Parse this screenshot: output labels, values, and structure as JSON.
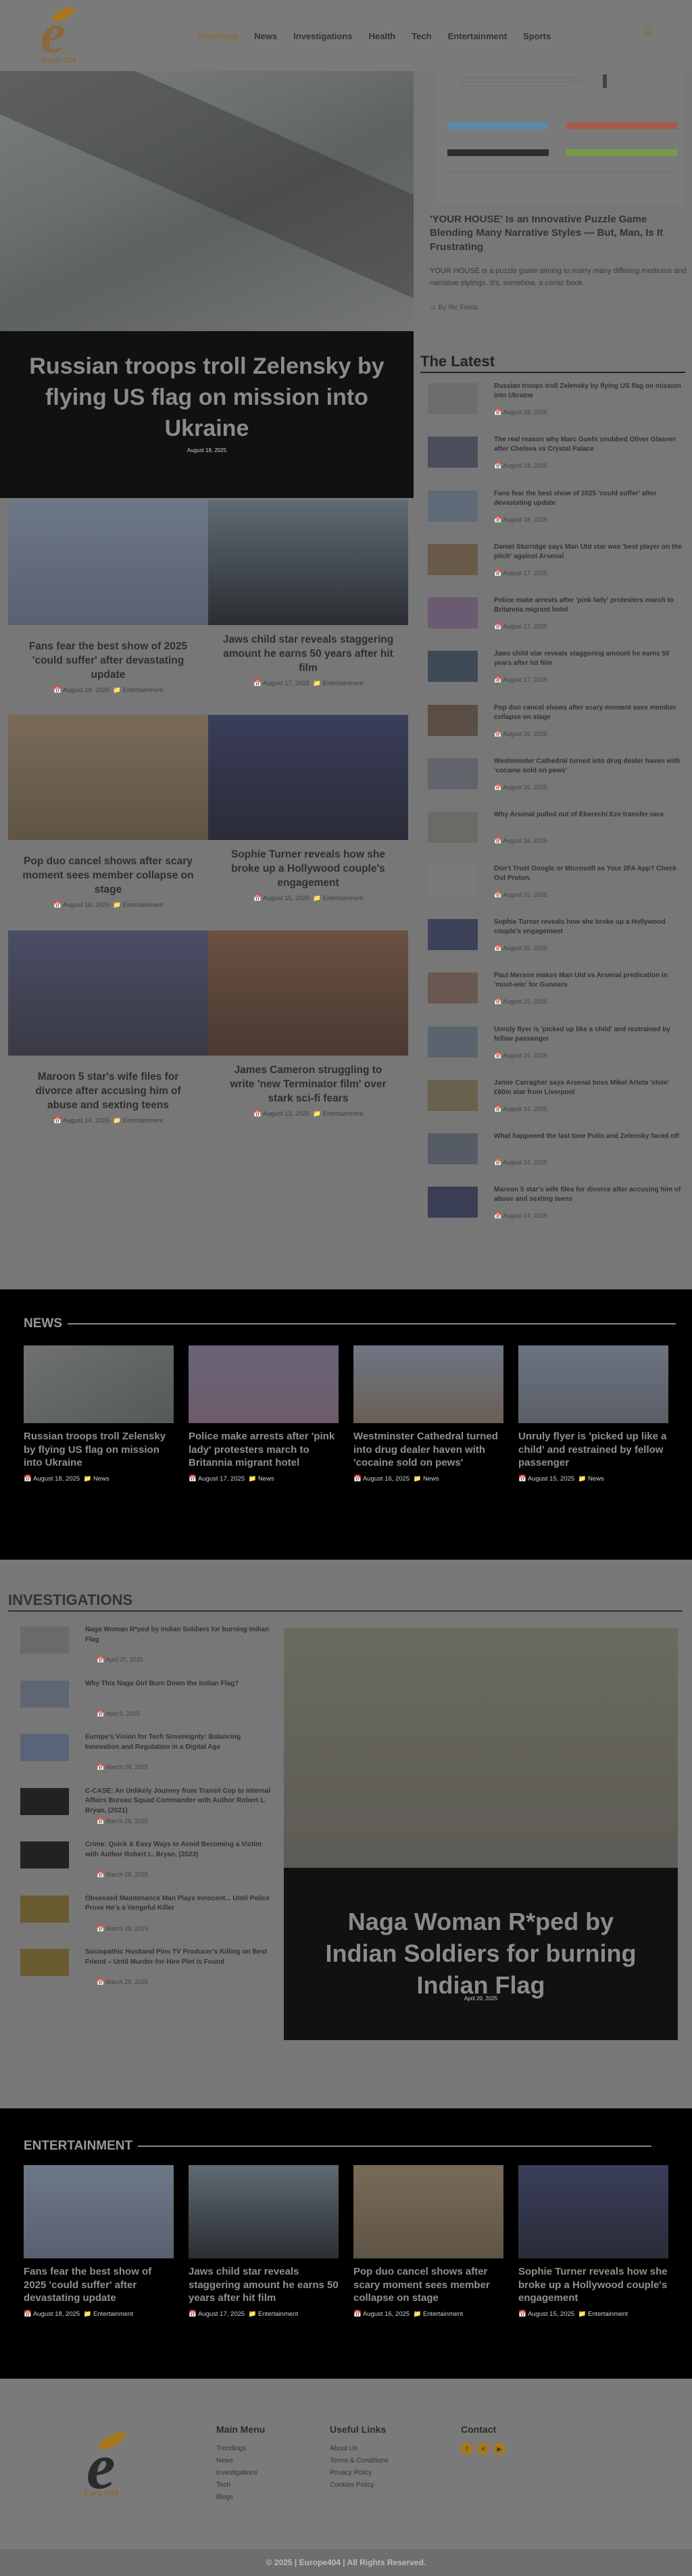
{
  "header": {
    "brand": "Euro 404",
    "nav": [
      "Trendings",
      "News",
      "Investigations",
      "Health",
      "Tech",
      "Entertainment",
      "Sports"
    ],
    "active_nav": "Trendings"
  },
  "hero": {
    "title": "Russian troops troll Zelensky by flying US flag on mission into Ukraine",
    "date": "August 18, 2025"
  },
  "feature": {
    "title": "'YOUR HOUSE' Is an Innovative Puzzle Game Blending Many Narrative Styles — But, Man, Is It Frustrating",
    "desc": "YOUR HOUSE is a puzzle game aiming to marry many differing mediums and narrative stylings. It's, somehow, a comic book.",
    "author": "By Ric Fields"
  },
  "latest": {
    "heading": "The Latest",
    "items": [
      {
        "title": "Russian troops troll Zelensky by flying US flag on mission into Ukraine",
        "date": "August 18, 2025"
      },
      {
        "title": "The real reason why Marc Guehi snubbed Oliver Glasner after Chelsea vs Crystal Palace",
        "date": "August 18, 2025"
      },
      {
        "title": "Fans fear the best show of 2025 'could suffer' after devastating update",
        "date": "August 18, 2025"
      },
      {
        "title": "Daniel Sturridge says Man Utd star was 'best player on the pitch' against Arsenal",
        "date": "August 17, 2025"
      },
      {
        "title": "Police make arrests after 'pink lady' protesters march to Britannia migrant hotel",
        "date": "August 17, 2025"
      },
      {
        "title": "Jaws child star reveals staggering amount he earns 50 years after hit film",
        "date": "August 17, 2025"
      },
      {
        "title": "Pop duo cancel shows after scary moment sees member collapse on stage",
        "date": "August 16, 2025"
      },
      {
        "title": "Westminster Cathedral turned into drug dealer haven with 'cocaine sold on pews'",
        "date": "August 16, 2025"
      },
      {
        "title": "Why Arsenal pulled out of Eberechi Eze transfer race",
        "date": "August 16, 2025"
      },
      {
        "title": "Don't Trust Google or Microsoft as Your 2FA App? Check Out Proton.",
        "date": "August 15, 2025"
      },
      {
        "title": "Sophie Turner reveals how she broke up a Hollywood couple's engagement",
        "date": "August 15, 2025"
      },
      {
        "title": "Paul Merson makes Man Utd vs Arsenal predication in 'must-win' for Gunners",
        "date": "August 15, 2025"
      },
      {
        "title": "Unruly flyer is 'picked up like a child' and restrained by fellow passenger",
        "date": "August 15, 2025"
      },
      {
        "title": "Jamie Carragher says Arsenal boss Mikel Arteta 'stole' £60m star from Liverpool",
        "date": "August 14, 2025"
      },
      {
        "title": "What happened the last time Putin and Zelensky faced off",
        "date": "August 14, 2025"
      },
      {
        "title": "Maroon 5 star's wife files for divorce after accusing him of abuse and sexting teens",
        "date": "August 14, 2025"
      }
    ]
  },
  "grid": [
    {
      "title": "Fans fear the best show of 2025 'could suffer' after devastating update",
      "date": "August 18, 2025",
      "cat": "Entertainment"
    },
    {
      "title": "Jaws child star reveals staggering amount he earns 50 years after hit film",
      "date": "August 17, 2025",
      "cat": "Entertainment"
    },
    {
      "title": "Pop duo cancel shows after scary moment sees member collapse on stage",
      "date": "August 16, 2025",
      "cat": "Entertainment"
    },
    {
      "title": "Sophie Turner reveals how she broke up a Hollywood couple's engagement",
      "date": "August 15, 2025",
      "cat": "Entertainment"
    },
    {
      "title": "Maroon 5 star's wife files for divorce after accusing him of abuse and sexting teens",
      "date": "August 14, 2025",
      "cat": "Entertainment"
    },
    {
      "title": "James Cameron struggling to write 'new Terminator film' over stark sci-fi fears",
      "date": "August 13, 2025",
      "cat": "Entertainment"
    }
  ],
  "news": {
    "heading": "NEWS",
    "items": [
      {
        "title": "Russian troops troll Zelensky by flying US flag on mission into Ukraine",
        "date": "August 18, 2025",
        "cat": "News"
      },
      {
        "title": "Police make arrests after 'pink lady' protesters march to Britannia migrant hotel",
        "date": "August 17, 2025",
        "cat": "News"
      },
      {
        "title": "Westminster Cathedral turned into drug dealer haven with 'cocaine sold on pews'",
        "date": "August 16, 2025",
        "cat": "News"
      },
      {
        "title": "Unruly flyer is 'picked up like a child' and restrained by fellow passenger",
        "date": "August 15, 2025",
        "cat": "News"
      }
    ]
  },
  "investigations": {
    "heading": "INVESTIGATIONS",
    "items": [
      {
        "title": "Naga Woman R*ped by Indian Soldiers for burning Indian Flag",
        "date": "April 20, 2025"
      },
      {
        "title": "Why This Naga Girl Burn Down the Indian Flag?",
        "date": "April 9, 2025"
      },
      {
        "title": "Europe's Vision for Tech Sovereignty: Balancing Innovation and Regulation in a Digital Age",
        "date": "March 28, 2025"
      },
      {
        "title": "C-CASE: An Unlikely Journey from Transit Cop to Internal Affairs Bureau Squad Commander with Author Robert L. Bryan, (2021)",
        "date": "March 28, 2025"
      },
      {
        "title": "Crime: Quick & Easy Ways to Avoid Becoming a Victim with Author Robert L. Bryan, (2023)",
        "date": "March 28, 2025"
      },
      {
        "title": "Obsessed Maintenance Man Plays Innocent... Until Police Prove He's a Vengeful Killer",
        "date": "March 28, 2025"
      },
      {
        "title": "Sociopathic Husband Pins TV Producer's Killing on Best Friend – Until Murder-for-Hire Plot is Found",
        "date": "March 28, 2025"
      }
    ],
    "feature_title": "Naga Woman R*ped by Indian Soldiers for burning Indian Flag",
    "feature_date": "April 20, 2025"
  },
  "entertainment": {
    "heading": "ENTERTAINMENT",
    "items": [
      {
        "title": "Fans fear the best show of 2025 'could suffer' after devastating update",
        "date": "August 18, 2025",
        "cat": "Entertainment"
      },
      {
        "title": "Jaws child star reveals staggering amount he earns 50 years after hit film",
        "date": "August 17, 2025",
        "cat": "Entertainment"
      },
      {
        "title": "Pop duo cancel shows after scary moment sees member collapse on stage",
        "date": "August 16, 2025",
        "cat": "Entertainment"
      },
      {
        "title": "Sophie Turner reveals how she broke up a Hollywood couple's engagement",
        "date": "August 15, 2025",
        "cat": "Entertainment"
      }
    ]
  },
  "footer": {
    "brand": "Euro 404",
    "main_menu_title": "Main Menu",
    "main_menu": [
      "Trendings",
      "News",
      "Investigations",
      "Tech",
      "Blogs"
    ],
    "useful_title": "Useful Links",
    "useful": [
      "About Us",
      "Terms & Conditions",
      "Privacy Policy",
      "Cookies Policy"
    ],
    "contact_title": "Contact",
    "copyright": "© 2025 | Europe404 | All Rights Reserved."
  },
  "colors": {
    "accent": "#a8781f",
    "page_bg": "#777777",
    "dark_section": "#000000"
  }
}
